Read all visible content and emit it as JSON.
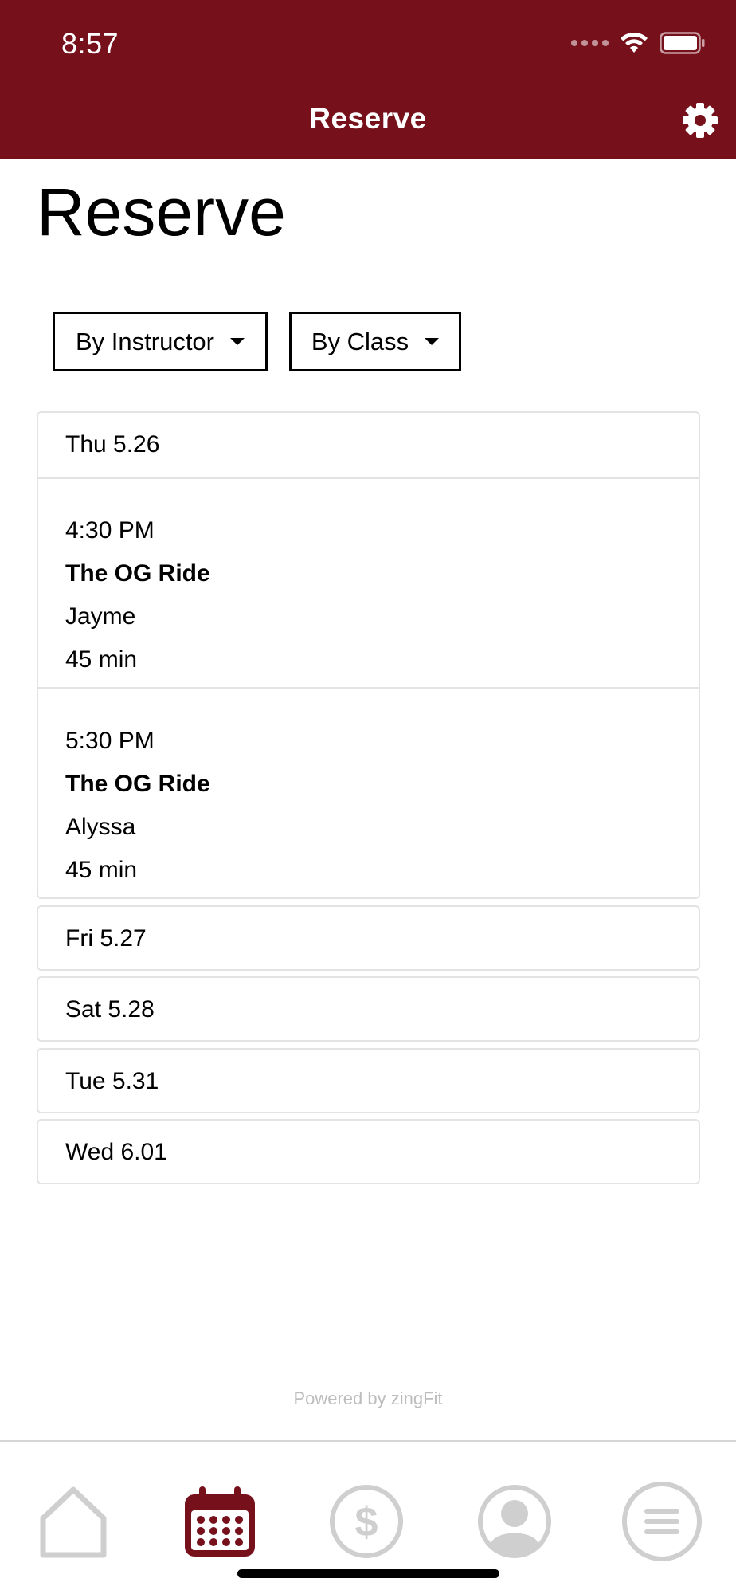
{
  "status_bar": {
    "time": "8:57"
  },
  "header": {
    "title": "Reserve"
  },
  "page": {
    "title": "Reserve"
  },
  "filters": [
    {
      "label": "By Instructor"
    },
    {
      "label": "By Class"
    }
  ],
  "days": [
    {
      "label": "Thu 5.26",
      "classes": [
        {
          "time": "4:30 PM",
          "name": "The OG Ride",
          "instructor": "Jayme",
          "duration": "45 min"
        },
        {
          "time": "5:30 PM",
          "name": "The OG Ride",
          "instructor": "Alyssa",
          "duration": "45 min"
        }
      ]
    },
    {
      "label": "Fri 5.27"
    },
    {
      "label": "Sat 5.28"
    },
    {
      "label": "Tue 5.31"
    },
    {
      "label": "Wed 6.01"
    }
  ],
  "footer": {
    "powered_by": "Powered by zingFit"
  },
  "tabs": [
    {
      "icon": "home-icon",
      "active": false
    },
    {
      "icon": "calendar-icon",
      "active": true
    },
    {
      "icon": "dollar-icon",
      "active": false
    },
    {
      "icon": "user-icon",
      "active": false
    },
    {
      "icon": "menu-icon",
      "active": false
    }
  ],
  "colors": {
    "brand": "#76111c",
    "inactive_icon": "#cfcfcf",
    "border": "#e3e3e3"
  }
}
